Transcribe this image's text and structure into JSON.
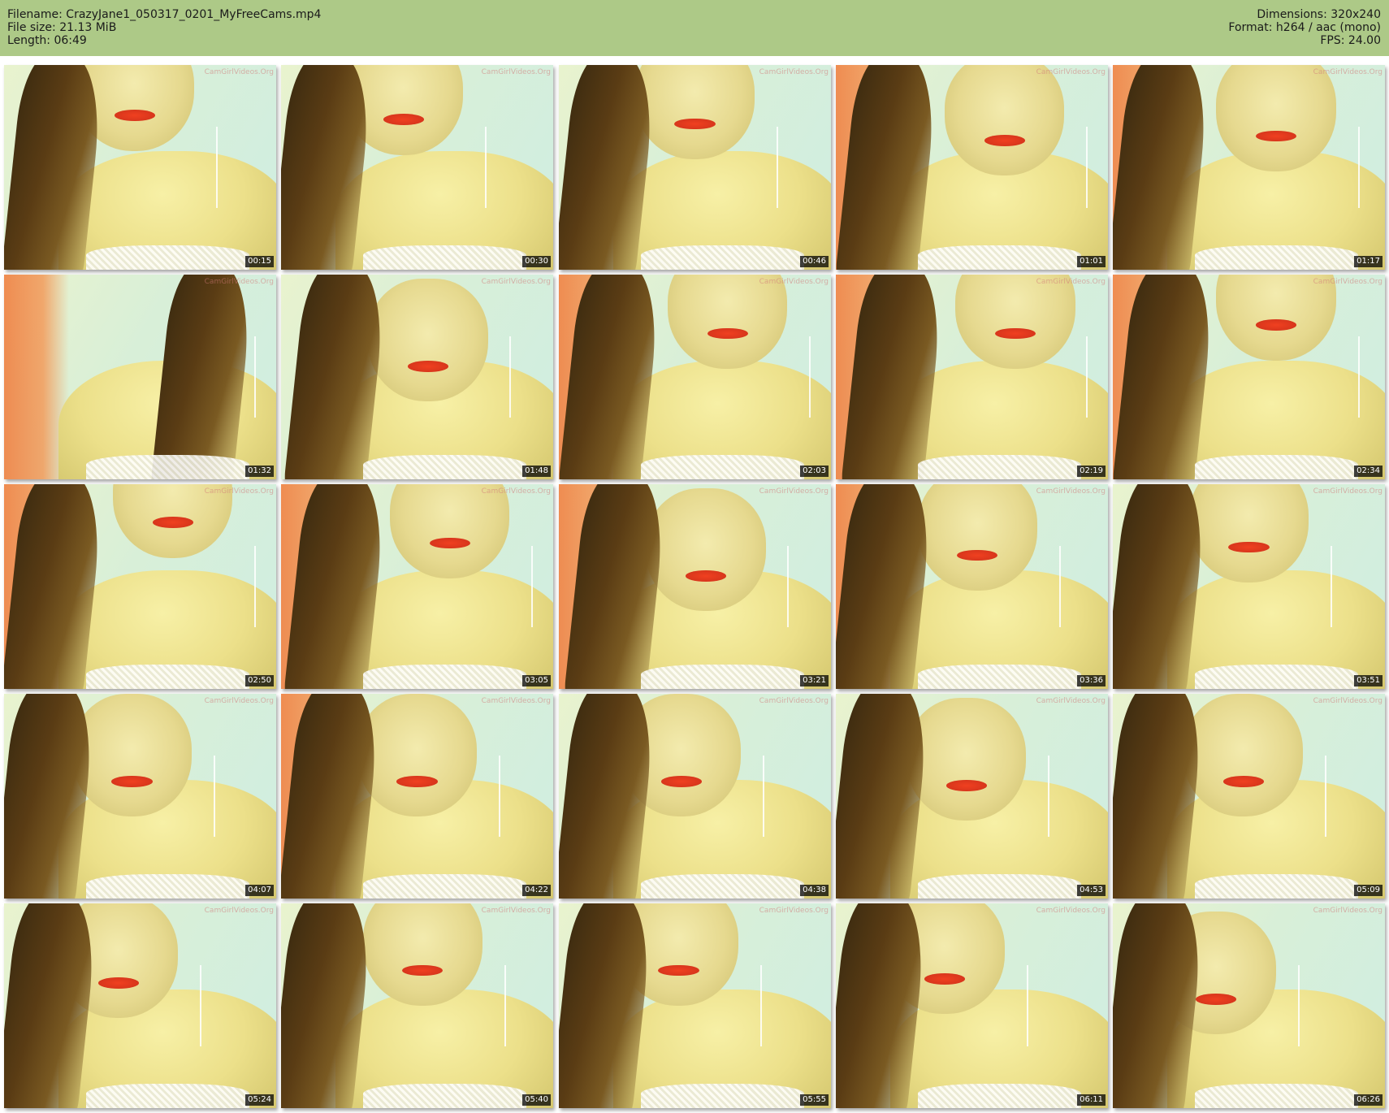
{
  "header": {
    "filename": "Filename: CrazyJane1_050317_0201_MyFreeCams.mp4",
    "filesize": "File size: 21.13 MiB",
    "length": "Length: 06:49",
    "dimensions": "Dimensions: 320x240",
    "format": "Format: h264 / aac (mono)",
    "fps": "FPS: 24.00"
  },
  "watermark_text": "CamGirlVideos.Org",
  "thumbnails": [
    {
      "time": "00:15"
    },
    {
      "time": "00:30"
    },
    {
      "time": "00:46"
    },
    {
      "time": "01:01"
    },
    {
      "time": "01:17"
    },
    {
      "time": "01:32"
    },
    {
      "time": "01:48"
    },
    {
      "time": "02:03"
    },
    {
      "time": "02:19"
    },
    {
      "time": "02:34"
    },
    {
      "time": "02:50"
    },
    {
      "time": "03:05"
    },
    {
      "time": "03:21"
    },
    {
      "time": "03:36"
    },
    {
      "time": "03:51"
    },
    {
      "time": "04:07"
    },
    {
      "time": "04:22"
    },
    {
      "time": "04:38"
    },
    {
      "time": "04:53"
    },
    {
      "time": "05:09"
    },
    {
      "time": "05:24"
    },
    {
      "time": "05:40"
    },
    {
      "time": "05:55"
    },
    {
      "time": "06:11"
    },
    {
      "time": "06:26"
    }
  ]
}
